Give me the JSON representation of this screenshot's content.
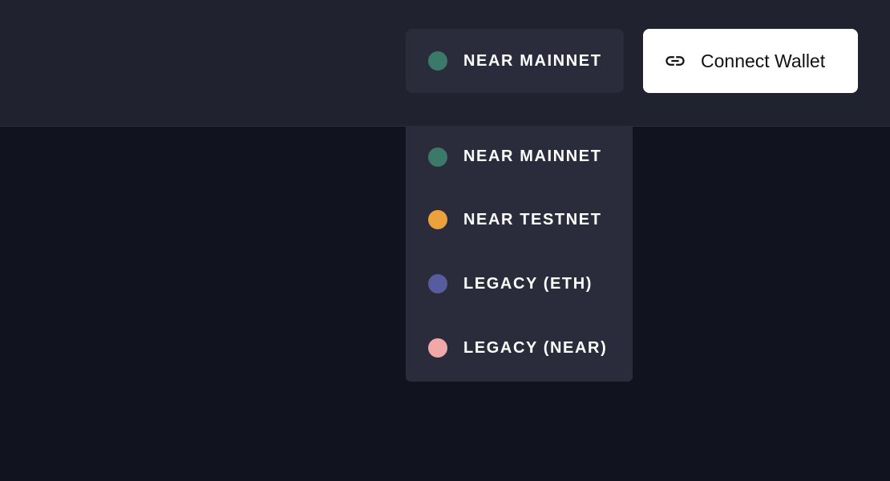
{
  "header": {
    "selected_network": {
      "label": "NEAR MAINNET",
      "color": "#3b7a68"
    },
    "connect_wallet": {
      "label": "Connect Wallet",
      "icon": "link-icon"
    }
  },
  "network_dropdown": {
    "items": [
      {
        "label": "NEAR MAINNET",
        "color": "#3b7a68"
      },
      {
        "label": "NEAR TESTNET",
        "color": "#eba23c"
      },
      {
        "label": "LEGACY (ETH)",
        "color": "#575c9f"
      },
      {
        "label": "LEGACY (NEAR)",
        "color": "#f0a9a6"
      }
    ]
  },
  "colors": {
    "page_background": "#11131f",
    "header_background": "#202230",
    "panel_background": "#2b2c3b"
  }
}
